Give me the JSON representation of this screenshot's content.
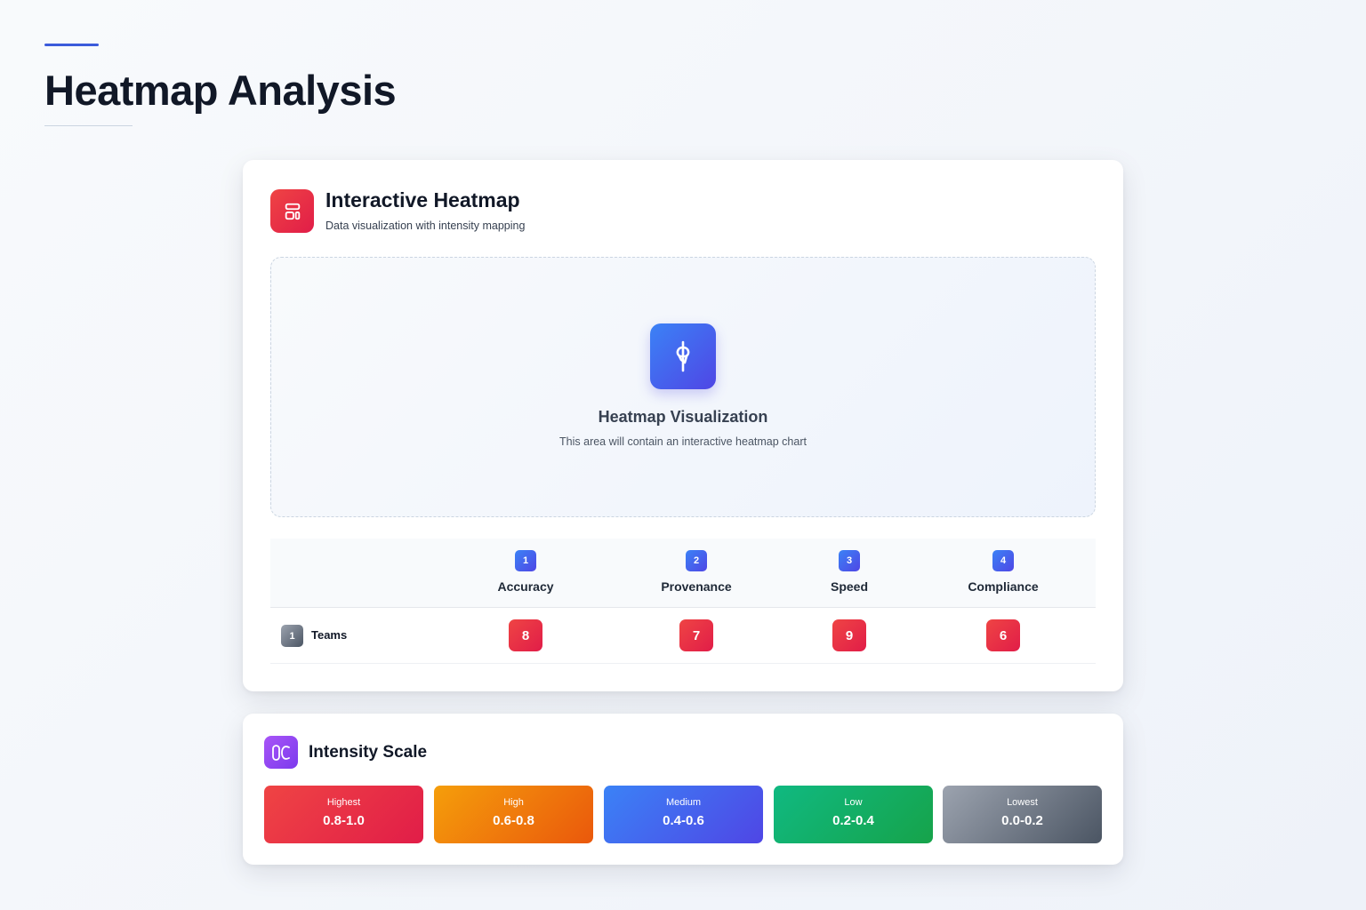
{
  "page": {
    "title": "Heatmap Analysis"
  },
  "main_card": {
    "title": "Interactive Heatmap",
    "subtitle": "Data visualization with intensity mapping",
    "icon": "layout-icon",
    "visualization": {
      "icon": "chart-icon",
      "title": "Heatmap Visualization",
      "subtitle": "This area will contain an interactive heatmap chart"
    },
    "table": {
      "columns": [
        {
          "num": "1",
          "label": "Accuracy"
        },
        {
          "num": "2",
          "label": "Provenance"
        },
        {
          "num": "3",
          "label": "Speed"
        },
        {
          "num": "4",
          "label": "Compliance"
        }
      ],
      "rows": [
        {
          "num": "1",
          "label": "Teams",
          "values": [
            "8",
            "7",
            "9",
            "6"
          ]
        }
      ]
    }
  },
  "scale_card": {
    "title": "Intensity Scale",
    "icon": "scale-icon",
    "items": [
      {
        "label": "Highest",
        "range": "0.8-1.0",
        "color_from": "#ef4444",
        "color_to": "#e11d48"
      },
      {
        "label": "High",
        "range": "0.6-0.8",
        "color_from": "#f59e0b",
        "color_to": "#ea580c"
      },
      {
        "label": "Medium",
        "range": "0.4-0.6",
        "color_from": "#3b82f6",
        "color_to": "#4f46e5"
      },
      {
        "label": "Low",
        "range": "0.2-0.4",
        "color_from": "#10b981",
        "color_to": "#16a34a"
      },
      {
        "label": "Lowest",
        "range": "0.0-0.2",
        "color_from": "#9ca3af",
        "color_to": "#4b5563"
      }
    ]
  }
}
